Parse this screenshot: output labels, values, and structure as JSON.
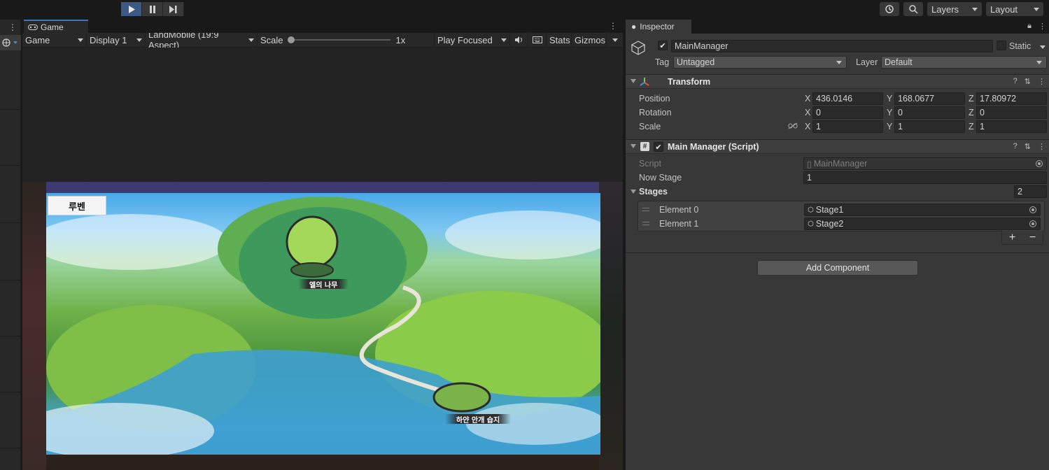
{
  "toolbar": {
    "layers_label": "Layers",
    "layout_label": "Layout"
  },
  "game_view": {
    "tab_label": "Game",
    "mode": "Game",
    "display": "Display 1",
    "aspect": "LandMobile (19:9 Aspect)",
    "scale_label": "Scale",
    "scale_value": "1x",
    "play_mode": "Play Focused",
    "stats_label": "Stats",
    "gizmos_label": "Gizmos",
    "scale_level": 0.0
  },
  "scene": {
    "region_button": "루벤",
    "stages": [
      {
        "name": "엘의 나무"
      },
      {
        "name": "하얀 안개 습지"
      }
    ]
  },
  "inspector": {
    "tab_label": "Inspector",
    "object_name": "MainManager",
    "active": true,
    "static_label": "Static",
    "tag_label": "Tag",
    "tag_value": "Untagged",
    "layer_label": "Layer",
    "layer_value": "Default",
    "transform": {
      "title": "Transform",
      "position_label": "Position",
      "rotation_label": "Rotation",
      "scale_label": "Scale",
      "position": {
        "x": "436.0146",
        "y": "168.0677",
        "z": "17.80972"
      },
      "rotation": {
        "x": "0",
        "y": "0",
        "z": "0"
      },
      "scale": {
        "x": "1",
        "y": "1",
        "z": "1"
      },
      "axis_x": "X",
      "axis_y": "Y",
      "axis_z": "Z"
    },
    "script_component": {
      "title": "Main Manager (Script)",
      "script_label": "Script",
      "script_value": "MainManager",
      "now_stage_label": "Now Stage",
      "now_stage_value": "1",
      "stages_label": "Stages",
      "stages_count": "2",
      "elements": [
        {
          "label": "Element 0",
          "value": "Stage1"
        },
        {
          "label": "Element 1",
          "value": "Stage2"
        }
      ]
    },
    "add_component_label": "Add Component"
  },
  "colors": {
    "play_active": "#3c5a85",
    "panel_bg": "#383838",
    "tab_accent": "#3a79bb"
  }
}
